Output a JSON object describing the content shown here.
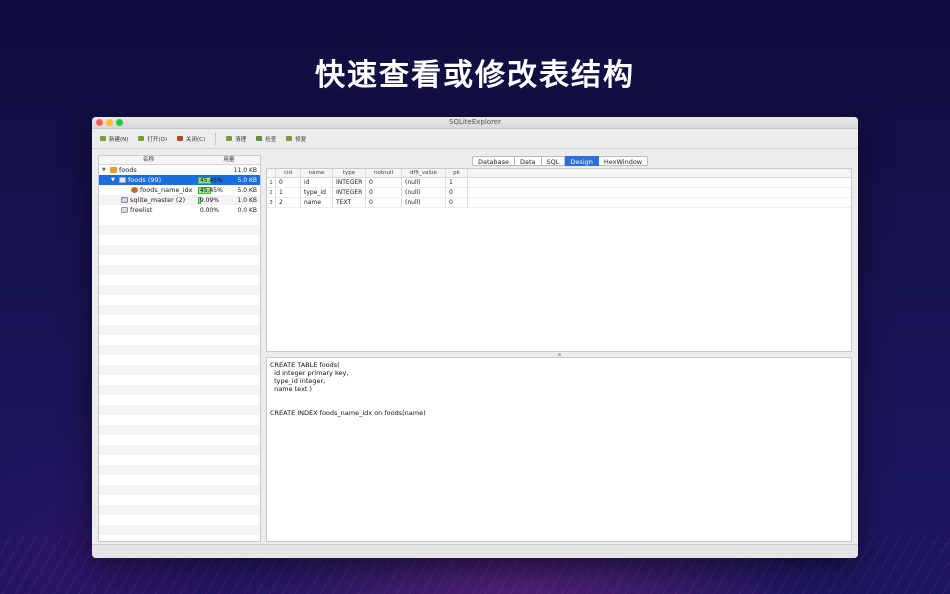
{
  "headline": "快速查看或修改表结构",
  "window": {
    "title": "SQLiteExplorer"
  },
  "toolbar": {
    "new_label": "新建(N)",
    "open_label": "打开(O)",
    "close_label": "关闭(C)",
    "clean_label": "清理",
    "check_label": "检查",
    "repair_label": "修复"
  },
  "tree": {
    "headers": {
      "name": "名称",
      "usage": "用量"
    },
    "rows": [
      {
        "name": "foods",
        "pct": "",
        "size": "11.0 KB"
      },
      {
        "name": "foods (99)",
        "pct": "45.45%",
        "size": "5.0 KB"
      },
      {
        "name": "foods_name_idx",
        "pct": "45.45%",
        "size": "5.0 KB"
      },
      {
        "name": "sqlite_master (2)",
        "pct": "9.09%",
        "size": "1.0 KB"
      },
      {
        "name": "freelist",
        "pct": "0.00%",
        "size": "0.0 KB"
      }
    ]
  },
  "tabs": [
    "Database",
    "Data",
    "SQL",
    "Design",
    "HexWindow"
  ],
  "active_tab": "Design",
  "grid": {
    "headers": [
      "cid",
      "name",
      "type",
      "notnull",
      "dflt_value",
      "pk"
    ],
    "rows": [
      {
        "rownum": "1",
        "cells": [
          "0",
          "id",
          "INTEGER",
          "0",
          "(null)",
          "1"
        ]
      },
      {
        "rownum": "2",
        "cells": [
          "1",
          "type_id",
          "INTEGER",
          "0",
          "(null)",
          "0"
        ]
      },
      {
        "rownum": "3",
        "cells": [
          "2",
          "name",
          "TEXT",
          "0",
          "(null)",
          "0"
        ]
      }
    ]
  },
  "sql": {
    "lines": [
      "CREATE TABLE foods(",
      "  id integer primary key,",
      "  type_id integer,",
      "  name text )",
      "",
      "",
      "CREATE INDEX foods_name_idx on foods(name)"
    ]
  },
  "colors": {
    "accent": "#1a6fe0",
    "usage_bar": "#9be37c"
  }
}
